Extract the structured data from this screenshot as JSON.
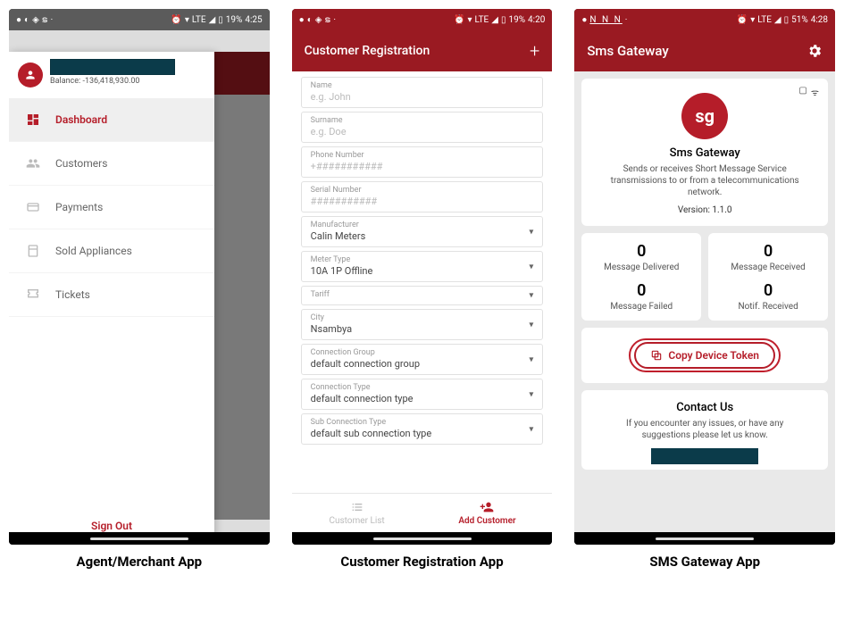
{
  "phone1": {
    "statusbar": {
      "battery": "19%",
      "time": "4:25",
      "lte": "LTE"
    },
    "balance_label": "Balance: -136,418,930.00",
    "menu": [
      {
        "name": "dashboard",
        "label": "Dashboard",
        "active": true
      },
      {
        "name": "customers",
        "label": "Customers"
      },
      {
        "name": "payments",
        "label": "Payments"
      },
      {
        "name": "sold-appliances",
        "label": "Sold Appliances"
      },
      {
        "name": "tickets",
        "label": "Tickets"
      }
    ],
    "signout": "Sign Out",
    "caption": "Agent/Merchant App"
  },
  "phone2": {
    "statusbar": {
      "battery": "19%",
      "time": "4:20",
      "lte": "LTE"
    },
    "header": "Customer Registration",
    "fields": {
      "name": {
        "label": "Name",
        "placeholder": "e.g. John"
      },
      "surname": {
        "label": "Surname",
        "placeholder": "e.g. Doe"
      },
      "phone": {
        "label": "Phone Number",
        "placeholder": "+###########"
      },
      "serial": {
        "label": "Serial Number",
        "placeholder": "###########"
      },
      "manufacturer": {
        "label": "Manufacturer",
        "value": "Calin Meters"
      },
      "meter_type": {
        "label": "Meter Type",
        "value": "10A 1P Offline"
      },
      "tariff": {
        "label": "Tariff",
        "value": ""
      },
      "city": {
        "label": "City",
        "value": "Nsambya"
      },
      "connection_group": {
        "label": "Connection Group",
        "value": "default connection group"
      },
      "connection_type": {
        "label": "Connection Type",
        "value": "default connection type"
      },
      "sub_connection_type": {
        "label": "Sub Connection Type",
        "value": "default  sub connection type"
      }
    },
    "tabs": {
      "list": "Customer List",
      "add": "Add Customer"
    },
    "caption": "Customer Registration App"
  },
  "phone3": {
    "statusbar": {
      "battery": "51%",
      "time": "4:28",
      "lte": "LTE",
      "n_icons": "N  N  N"
    },
    "header": "Sms Gateway",
    "logo_text": "sg",
    "app_title": "Sms Gateway",
    "app_desc": "Sends or receives Short Message Service transmissions to or from a telecommunications network.",
    "version": "Version: 1.1.0",
    "stats": {
      "delivered": {
        "value": "0",
        "label": "Message Delivered"
      },
      "failed": {
        "value": "0",
        "label": "Message Failed"
      },
      "received": {
        "value": "0",
        "label": "Message Received"
      },
      "notif": {
        "value": "0",
        "label": "Notif. Received"
      }
    },
    "copy_btn": "Copy Device Token",
    "contact_title": "Contact Us",
    "contact_desc": "If you encounter any issues, or have any suggestions please let us know.",
    "caption": "SMS Gateway App"
  }
}
